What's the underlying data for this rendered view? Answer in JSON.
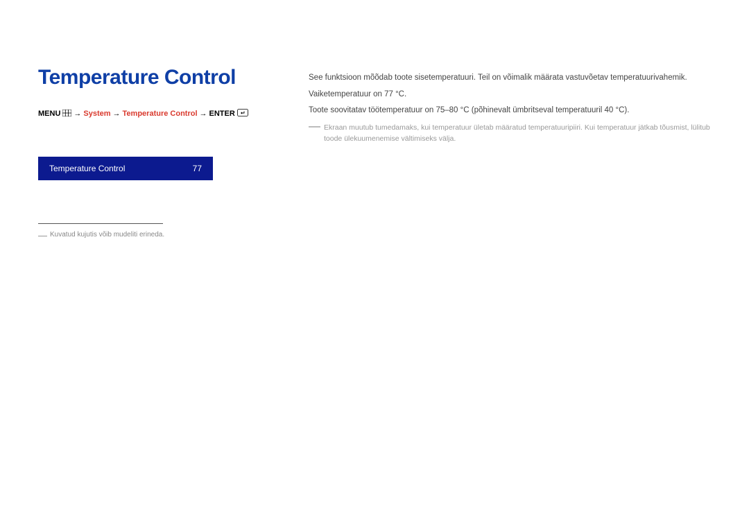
{
  "heading": "Temperature Control",
  "breadcrumb": {
    "menu": "MENU",
    "arrow": "→",
    "part1": "System",
    "part2": "Temperature Control",
    "enter": "ENTER"
  },
  "blueBar": {
    "label": "Temperature Control",
    "value": "77"
  },
  "footnote": {
    "dash": "―",
    "text": "Kuvatud kujutis võib mudeliti erineda."
  },
  "body": {
    "p1": "See funktsioon mõõdab toote sisetemperatuuri. Teil on võimalik määrata vastuvõetav temperatuurivahemik.",
    "p2": "Vaiketemperatuur on 77 °C.",
    "p3": "Toote soovitatav töötemperatuur on 75–80 °C (põhinevalt ümbritseval temperatuuril 40 °C)."
  },
  "note": {
    "dash": "―",
    "text": "Ekraan muutub tumedamaks, kui temperatuur ületab määratud temperatuuripiiri. Kui temperatuur jätkab tõusmist, lülitub toode ülekuumenemise vältimiseks välja."
  }
}
